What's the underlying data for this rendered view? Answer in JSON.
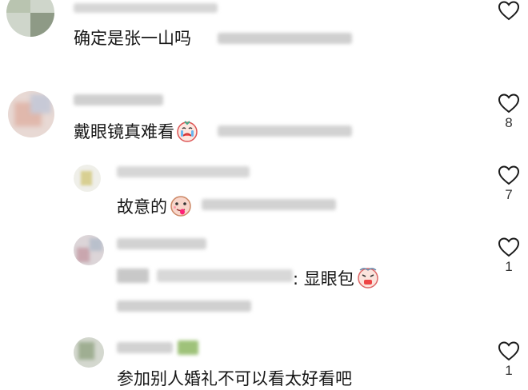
{
  "comments": [
    {
      "text": "确定是张一山吗",
      "likes": ""
    },
    {
      "text": "戴眼镜真难看",
      "likes": "8"
    },
    {
      "text": "故意的",
      "likes": "7"
    },
    {
      "reply_tail": ": 显眼包",
      "likes": "1"
    },
    {
      "text": "参加别人婚礼不可以看太好看吧",
      "likes": "1"
    }
  ],
  "icons": {
    "like": "heart-outline-icon",
    "emoji_cry": "crying-face-emoji-icon",
    "emoji_tongue": "tongue-face-emoji-icon",
    "emoji_scared": "scared-face-emoji-icon"
  },
  "colors": {
    "text": "#161616",
    "muted": "#bdbdbd",
    "heart_stroke": "#1a1a1a"
  }
}
